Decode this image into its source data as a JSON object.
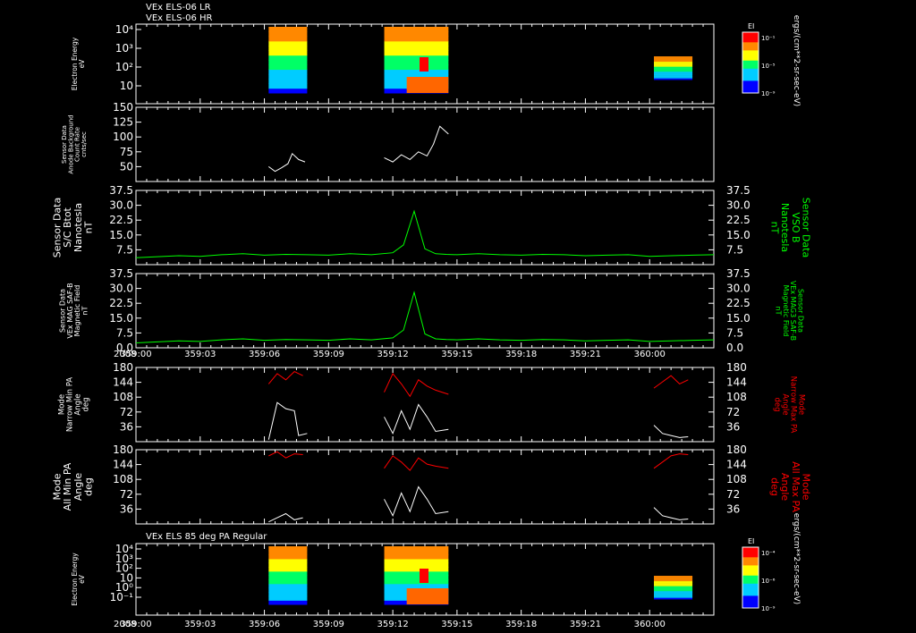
{
  "header": {
    "line1": "VEx ELS-06 LR",
    "line2": "VEx ELS-06 HR"
  },
  "colors": {
    "background": "#000000",
    "axes": "#ffffff",
    "green_series": "#00ff00",
    "red_series": "#ff0000",
    "white_series": "#ffffff"
  },
  "time_axis": {
    "year": "2008",
    "ticks": [
      "359:00",
      "359:03",
      "359:06",
      "359:09",
      "359:12",
      "359:15",
      "359:18",
      "359:21",
      "360:00"
    ],
    "range_min": [
      0,
      27
    ]
  },
  "chart_data": [
    {
      "type": "heatmap",
      "id": "spec1",
      "ylabel": [
        "Electron Energy",
        "eV"
      ],
      "y_scale": "log",
      "y_tick_labels": [
        "10",
        "10²",
        "10³",
        "10⁴"
      ],
      "colorbar": {
        "title": "EI",
        "tick_labels": [
          "10⁻¹",
          "10⁻⁵",
          "10⁻⁹"
        ]
      },
      "side_label": "ergs/(cm**2-sr-sec-eV)",
      "data_blocks_min": [
        [
          6.2,
          8.0
        ],
        [
          11.6,
          14.6
        ],
        [
          24.2,
          26.0
        ]
      ]
    },
    {
      "type": "line",
      "id": "background",
      "ylabel": [
        "Sensor Data",
        "Anode Background",
        "Count Rate",
        "cnts/sec"
      ],
      "ylim": [
        25,
        150
      ],
      "y_ticks": [
        50,
        75,
        100,
        125,
        150
      ],
      "y_tick_labels": [
        "50",
        "75",
        "100",
        "125",
        "150"
      ],
      "series": [
        {
          "color": "white",
          "x": [
            6.2,
            6.5,
            6.8,
            7.1,
            7.3,
            7.6,
            7.9
          ],
          "y": [
            50,
            42,
            48,
            55,
            72,
            62,
            58
          ]
        },
        {
          "color": "white",
          "x": [
            11.6,
            12.0,
            12.4,
            12.8,
            13.2,
            13.6,
            13.9,
            14.2,
            14.6
          ],
          "y": [
            65,
            58,
            70,
            62,
            75,
            68,
            88,
            118,
            105
          ]
        }
      ]
    },
    {
      "type": "line",
      "id": "btot",
      "ylabel": [
        "Sensor Data",
        "S/C Btot",
        "Nanotesla",
        "nT"
      ],
      "right_label": [
        "Sensor Data",
        "VSO B",
        "Nanotesla",
        "nT"
      ],
      "ylim": [
        0,
        37.5
      ],
      "y_ticks": [
        7.5,
        15,
        22.5,
        30,
        37.5
      ],
      "y_tick_labels": [
        "7.5",
        "15.0",
        "22.5",
        "30.0",
        "37.5"
      ],
      "series": [
        {
          "color": "green",
          "x": [
            0,
            1,
            2,
            3,
            4,
            5,
            6,
            7,
            8,
            9,
            10,
            11,
            12,
            12.5,
            13,
            13.5,
            14,
            14.5,
            15,
            16,
            17,
            18,
            19,
            20,
            21,
            22,
            23,
            24,
            25,
            26,
            27
          ],
          "y": [
            3.5,
            4.0,
            4.5,
            4.2,
            5.0,
            5.5,
            4.8,
            5.2,
            5.0,
            4.8,
            5.5,
            5.0,
            6.0,
            10,
            27,
            8,
            5.5,
            5.2,
            5.0,
            5.5,
            5.0,
            4.8,
            5.2,
            5.0,
            4.5,
            4.8,
            5.0,
            4.2,
            4.5,
            4.8,
            5.0
          ]
        }
      ]
    },
    {
      "type": "line",
      "id": "mag",
      "ylabel": [
        "Sensor Data",
        "VEx MAG SAF-B",
        "Magnetic Field",
        "nT"
      ],
      "right_label": [
        "Sensor Data",
        "VEx MAG3 SAF-B",
        "Magnetic Field",
        "nT"
      ],
      "ylim": [
        0,
        37.5
      ],
      "y_ticks": [
        0,
        7.5,
        15,
        22.5,
        30,
        37.5
      ],
      "y_tick_labels": [
        "0.0",
        "7.5",
        "15.0",
        "22.5",
        "30.0",
        "37.5"
      ],
      "series": [
        {
          "color": "green",
          "x": [
            0,
            1,
            2,
            3,
            4,
            5,
            6,
            7,
            8,
            9,
            10,
            11,
            12,
            12.5,
            13,
            13.5,
            14,
            14.5,
            15,
            16,
            17,
            18,
            19,
            20,
            21,
            22,
            23,
            24,
            25,
            26,
            27
          ],
          "y": [
            2.5,
            3.0,
            3.5,
            3.2,
            4.0,
            4.5,
            3.8,
            4.2,
            4.0,
            3.8,
            4.5,
            4.0,
            5.0,
            9,
            28,
            7,
            4.5,
            4.2,
            4.0,
            4.5,
            4.0,
            3.8,
            4.2,
            4.0,
            3.5,
            3.8,
            4.0,
            3.2,
            3.5,
            3.8,
            4.0
          ]
        }
      ]
    },
    {
      "type": "line",
      "id": "narrow",
      "ylabel": [
        "Mode",
        "Narrow Min PA",
        "Angle",
        "deg"
      ],
      "right_label": [
        "Mode",
        "Narrow Max PA",
        "Angle",
        "deg"
      ],
      "ylim": [
        0,
        180
      ],
      "y_ticks": [
        36,
        72,
        108,
        144,
        180
      ],
      "y_tick_labels": [
        "36",
        "72",
        "108",
        "144",
        "180"
      ],
      "series": [
        {
          "color": "red",
          "x": [
            6.2,
            6.6,
            7.0,
            7.4,
            7.8
          ],
          "y": [
            140,
            165,
            150,
            170,
            160
          ]
        },
        {
          "color": "red",
          "x": [
            11.6,
            12.0,
            12.4,
            12.8,
            13.2,
            13.6,
            14.0,
            14.6
          ],
          "y": [
            120,
            165,
            140,
            110,
            150,
            135,
            125,
            115
          ]
        },
        {
          "color": "red",
          "x": [
            24.2,
            24.6,
            25.0,
            25.4,
            25.8
          ],
          "y": [
            130,
            145,
            160,
            140,
            150
          ]
        },
        {
          "color": "white",
          "x": [
            6.2,
            6.6,
            7.0,
            7.4,
            7.6,
            8.0
          ],
          "y": [
            5,
            95,
            80,
            75,
            15,
            20
          ]
        },
        {
          "color": "white",
          "x": [
            11.6,
            12.0,
            12.4,
            12.8,
            13.2,
            13.6,
            14.0,
            14.6
          ],
          "y": [
            60,
            20,
            75,
            30,
            90,
            60,
            25,
            30
          ]
        },
        {
          "color": "white",
          "x": [
            24.2,
            24.6,
            25.0,
            25.4,
            25.8
          ],
          "y": [
            40,
            20,
            15,
            10,
            12
          ]
        }
      ]
    },
    {
      "type": "line",
      "id": "all",
      "ylabel": [
        "Mode",
        "All Min PA",
        "Angle",
        "deg"
      ],
      "right_label": [
        "Mode",
        "All Max PA",
        "Angle",
        "deg"
      ],
      "ylim": [
        0,
        180
      ],
      "y_ticks": [
        36,
        72,
        108,
        144,
        180
      ],
      "y_tick_labels": [
        "36",
        "72",
        "108",
        "144",
        "180"
      ],
      "series": [
        {
          "color": "red",
          "x": [
            6.2,
            6.6,
            7.0,
            7.4,
            7.8
          ],
          "y": [
            165,
            175,
            160,
            170,
            168
          ]
        },
        {
          "color": "red",
          "x": [
            11.6,
            12.0,
            12.4,
            12.8,
            13.2,
            13.6,
            14.0,
            14.6
          ],
          "y": [
            135,
            165,
            150,
            130,
            160,
            145,
            140,
            135
          ]
        },
        {
          "color": "red",
          "x": [
            24.2,
            24.6,
            25.0,
            25.4,
            25.8
          ],
          "y": [
            135,
            150,
            165,
            170,
            168
          ]
        },
        {
          "color": "white",
          "x": [
            6.2,
            6.6,
            7.0,
            7.4,
            7.8
          ],
          "y": [
            5,
            15,
            25,
            10,
            15
          ]
        },
        {
          "color": "white",
          "x": [
            11.6,
            12.0,
            12.4,
            12.8,
            13.2,
            13.6,
            14.0,
            14.6
          ],
          "y": [
            60,
            20,
            75,
            30,
            90,
            60,
            25,
            30
          ]
        },
        {
          "color": "white",
          "x": [
            24.2,
            24.6,
            25.0,
            25.4,
            25.8
          ],
          "y": [
            40,
            20,
            15,
            10,
            12
          ]
        }
      ]
    },
    {
      "type": "heatmap",
      "id": "spec2",
      "title": "VEx ELS 85 deg PA Regular",
      "ylabel": [
        "Electron Energy",
        "eV"
      ],
      "y_scale": "log",
      "y_tick_labels": [
        "10⁻¹",
        "10⁰",
        "10",
        "10²",
        "10³",
        "10⁴"
      ],
      "colorbar": {
        "title": "EI",
        "tick_labels": [
          "10⁻⁴",
          "10⁻⁶",
          "10⁻⁹"
        ]
      },
      "side_label": "ergs/(cm**2-sr-sec-eV)",
      "data_blocks_min": [
        [
          6.2,
          8.0
        ],
        [
          11.6,
          14.6
        ],
        [
          24.2,
          26.0
        ]
      ]
    }
  ]
}
